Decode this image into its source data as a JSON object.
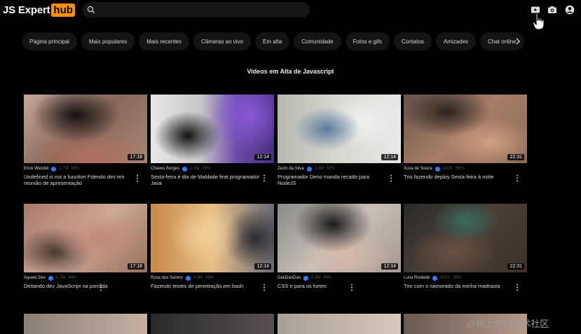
{
  "header": {
    "logo_js": "JS Expert",
    "logo_hub": "hub",
    "search_placeholder": ""
  },
  "nav": {
    "items": [
      "Página principal",
      "Mais populares",
      "Mais recentes",
      "Câmeras ao vivo",
      "Em alta",
      "Comunidade",
      "Fotos e gifs",
      "Contatos",
      "Amizades",
      "Chat online"
    ]
  },
  "section": {
    "title": "Videos em Alta de Javascript"
  },
  "videos": [
    {
      "author": "Erick Wendel",
      "views": "1.7M",
      "rating": "99%",
      "duration": "17:18",
      "title": "Undefined is not a function f*dendo dev em reunião de apresentação"
    },
    {
      "author": "Chaves Borges",
      "views": "2.3M",
      "rating": "99%",
      "duration": "12:14",
      "title": "Sexta-feira é dia de Maldade feat programador Java"
    },
    {
      "author": "Zezin da Silva",
      "views": "2.3M",
      "rating": "99%",
      "duration": "12:14",
      "title": "Programador Deno manda recado para NodeJS"
    },
    {
      "author": "Xuxa de Souza",
      "views": "441K",
      "rating": "99%",
      "duration": "22:31",
      "title": "Trio fazendo deploy Sexta-feira à noite"
    },
    {
      "author": "Aquele Dev",
      "views": "1.7M",
      "rating": "99%",
      "duration": "17:18",
      "title": "Deitando dev JavaScript na porrada"
    },
    {
      "author": "Rosa dos Santos",
      "views": "2.3M",
      "rating": "99%",
      "duration": "12:14",
      "title": "Fazendo testes de penetração em bash"
    },
    {
      "author": "DanDanDan",
      "views": "2.3M",
      "rating": "99%",
      "duration": "12:14",
      "title": "CSS e para os fortes"
    },
    {
      "author": "Luna Roulette",
      "views": "441K",
      "rating": "99%",
      "duration": "22:31",
      "title": "Trio com o namorado da minha madrasta"
    }
  ],
  "watermark": "@稀土掘金技术社区",
  "colors": {
    "brand_orange": "#ff9000",
    "verified_blue": "#2e7cf6"
  }
}
